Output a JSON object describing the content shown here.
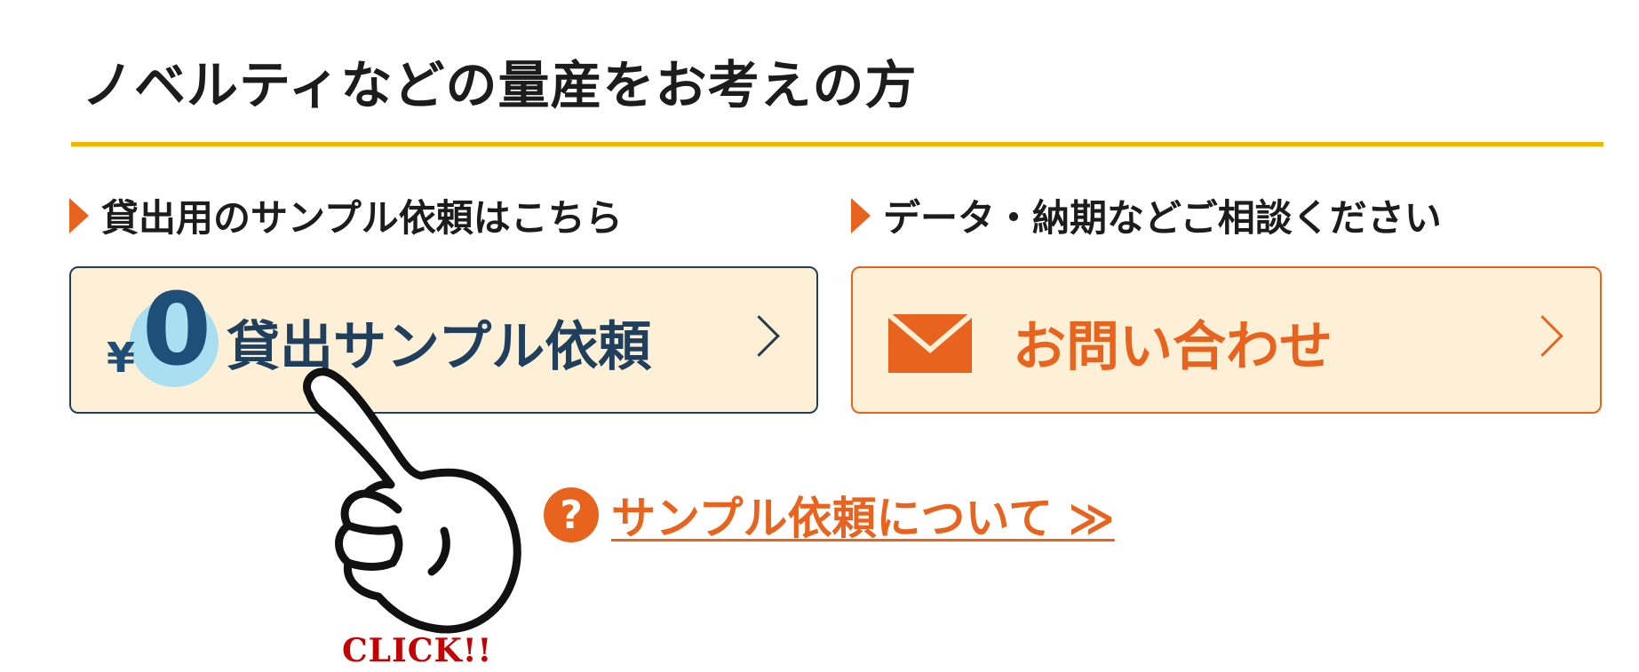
{
  "section": {
    "title": "ノベルティなどの量産をお考えの方",
    "accent_color": "#f5b400"
  },
  "left": {
    "label": "貸出用のサンプル依頼はこちら",
    "button": {
      "badge_currency": "¥",
      "badge_value": "0",
      "text": "貸出サンプル依頼",
      "icon": "chevron-right-icon"
    }
  },
  "right": {
    "label": "データ・納期などご相談ください",
    "button": {
      "icon": "mail-icon",
      "text": "お問い合わせ",
      "chevron": "chevron-right-icon"
    }
  },
  "link": {
    "icon": "question-icon",
    "icon_text": "?",
    "text": "サンプル依頼について ≫"
  },
  "click_callout": {
    "icon": "pointing-hand-icon",
    "text": "CLICK!!"
  },
  "colors": {
    "orange": "#e8641e",
    "navy": "#1f3f5c",
    "button_bg": "#fdf0d6",
    "badge_blue": "#a9dff0",
    "click_red": "#c40000"
  }
}
